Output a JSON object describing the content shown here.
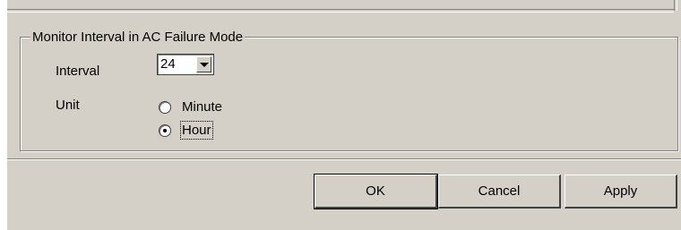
{
  "group": {
    "title": "Monitor Interval in AC Failure Mode"
  },
  "interval": {
    "label": "Interval",
    "value": "24"
  },
  "unit": {
    "label": "Unit",
    "options": [
      {
        "label": "Minute",
        "selected": false
      },
      {
        "label": "Hour",
        "selected": true
      }
    ]
  },
  "buttons": {
    "ok": "OK",
    "cancel": "Cancel",
    "apply": "Apply"
  },
  "colors": {
    "face": "#d4d0c8",
    "shadow": "#808080",
    "dark_shadow": "#404040",
    "highlight": "#ffffff"
  },
  "icons": {
    "combo_arrow": "chevron-down-icon"
  }
}
